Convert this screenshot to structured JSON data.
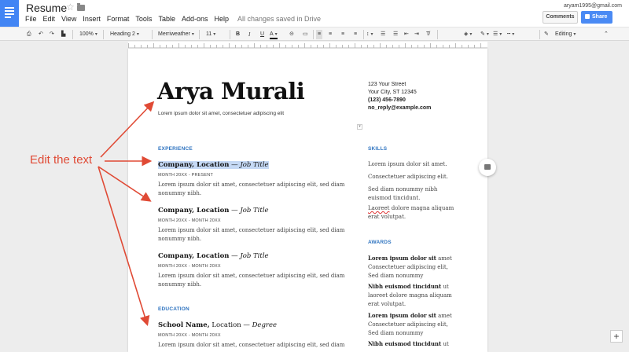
{
  "header": {
    "title": "Resume",
    "menu": [
      "File",
      "Edit",
      "View",
      "Insert",
      "Format",
      "Tools",
      "Table",
      "Add-ons",
      "Help"
    ],
    "saved_status": "All changes saved in Drive",
    "email": "aryam1995@gmail.com",
    "comments_label": "Comments",
    "share_label": "Share"
  },
  "toolbar": {
    "zoom": "100%",
    "style": "Heading 2",
    "font": "Merriweather",
    "size": "11",
    "bold": "B",
    "italic": "I",
    "underline": "U",
    "text_color": "A",
    "mode": "Editing"
  },
  "resume": {
    "name": "Arya Murali",
    "tagline": "Lorem ipsum dolor sit amet, consectetuer adipiscing elit",
    "address_line1": "123 Your Street",
    "address_line2": "Your City, ST 12345",
    "phone": "(123) 456-7890",
    "email": "no_reply@example.com",
    "experience_heading": "EXPERIENCE",
    "jobs": [
      {
        "company": "Company, Location",
        "dash": " — ",
        "title": "Job Title",
        "dates": "MONTH 20XX - PRESENT",
        "desc": "Lorem ipsum dolor sit amet, consectetuer adipiscing elit, sed diam nonummy nibh."
      },
      {
        "company": "Company, Location",
        "dash": " — ",
        "title": "Job Title",
        "dates": "MONTH 20XX - MONTH 20XX",
        "desc": "Lorem ipsum dolor sit amet, consectetuer adipiscing elit, sed diam nonummy nibh."
      },
      {
        "company": "Company, Location",
        "dash": " — ",
        "title": "Job Title",
        "dates": "MONTH 20XX - MONTH 20XX",
        "desc": "Lorem ipsum dolor sit amet, consectetuer adipiscing elit, sed diam nonummy nibh."
      }
    ],
    "education_heading": "EDUCATION",
    "school": {
      "name": "School Name,",
      "location": " Location",
      "dash": " — ",
      "degree": "Degree",
      "dates": "MONTH 20XX - MONTH 20XX",
      "desc": "Lorem ipsum dolor sit amet, consectetuer adipiscing elit, sed diam"
    },
    "skills_heading": "SKILLS",
    "skills": [
      "Lorem ipsum dolor sit amet.",
      "Consectetuer adipiscing elit.",
      "Sed diam nonummy nibh euismod tincidunt.",
      "Laoreet",
      " dolore magna aliquam erat volutpat."
    ],
    "awards_heading": "AWARDS",
    "awards": [
      {
        "bold": "Lorem ipsum dolor sit",
        "rest": " amet Consectetuer adipiscing elit, Sed diam nonummy"
      },
      {
        "bold": "Nibh euismod tincidunt",
        "rest": " ut laoreet dolore magna aliquam erat volutpat."
      },
      {
        "bold": "Lorem ipsum dolor sit",
        "rest": " amet Consectetuer adipiscing elit, Sed diam nonummy"
      },
      {
        "bold": "Nibh euismod tincidunt",
        "rest": " ut"
      }
    ]
  },
  "annotation": {
    "text": "Edit the text",
    "color": "#e04a35"
  }
}
